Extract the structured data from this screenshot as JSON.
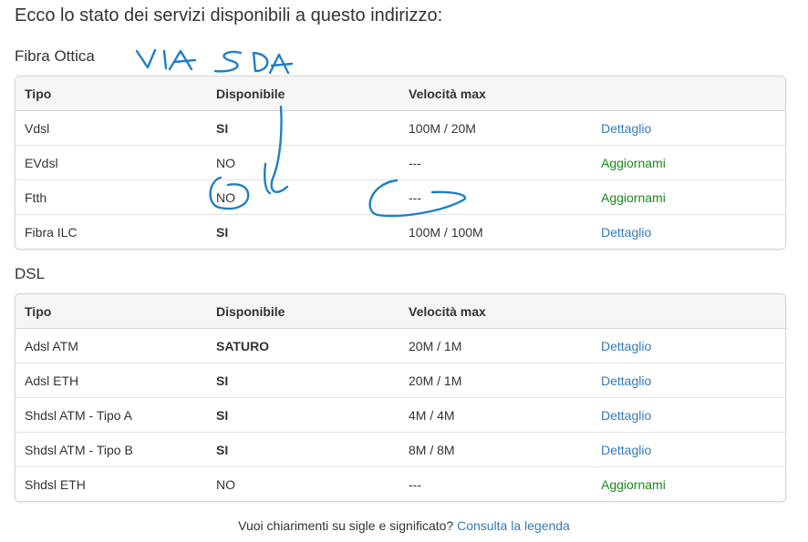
{
  "intro": "Ecco lo stato dei servizi disponibili a questo indirizzo:",
  "headers": {
    "tipo": "Tipo",
    "disponibile": "Disponibile",
    "velocita": "Velocità max"
  },
  "fibra": {
    "title": "Fibra Ottica",
    "rows": [
      {
        "tipo": "Vdsl",
        "disponibile": "SI",
        "disp_bold": true,
        "velocita": "100M / 20M",
        "action": "Dettaglio",
        "action_type": "link"
      },
      {
        "tipo": "EVdsl",
        "disponibile": "NO",
        "disp_bold": false,
        "velocita": "---",
        "action": "Aggiornami",
        "action_type": "green"
      },
      {
        "tipo": "Ftth",
        "disponibile": "NO",
        "disp_bold": false,
        "velocita": "---",
        "action": "Aggiornami",
        "action_type": "green"
      },
      {
        "tipo": "Fibra ILC",
        "disponibile": "SI",
        "disp_bold": true,
        "velocita": "100M / 100M",
        "action": "Dettaglio",
        "action_type": "link"
      }
    ]
  },
  "dsl": {
    "title": "DSL",
    "rows": [
      {
        "tipo": "Adsl ATM",
        "disponibile": "SATURO",
        "disp_bold": true,
        "velocita": "20M / 1M",
        "action": "Dettaglio",
        "action_type": "link"
      },
      {
        "tipo": "Adsl ETH",
        "disponibile": "SI",
        "disp_bold": true,
        "velocita": "20M / 1M",
        "action": "Dettaglio",
        "action_type": "link"
      },
      {
        "tipo": "Shdsl ATM - Tipo A",
        "disponibile": "SI",
        "disp_bold": true,
        "velocita": "4M / 4M",
        "action": "Dettaglio",
        "action_type": "link"
      },
      {
        "tipo": "Shdsl ATM - Tipo B",
        "disponibile": "SI",
        "disp_bold": true,
        "velocita": "8M / 8M",
        "action": "Dettaglio",
        "action_type": "link"
      },
      {
        "tipo": "Shdsl ETH",
        "disponibile": "NO",
        "disp_bold": false,
        "velocita": "---",
        "action": "Aggiornami",
        "action_type": "green"
      }
    ]
  },
  "footer": {
    "text": "Vuoi chiarimenti su sigle e significato?",
    "link": "Consulta la legenda"
  },
  "handwriting": {
    "text": "VIA SDA",
    "color": "#1f7fc4"
  },
  "colors": {
    "link": "#337ab7",
    "action_green": "#1a8a1a",
    "ink": "#1f7fc4"
  }
}
